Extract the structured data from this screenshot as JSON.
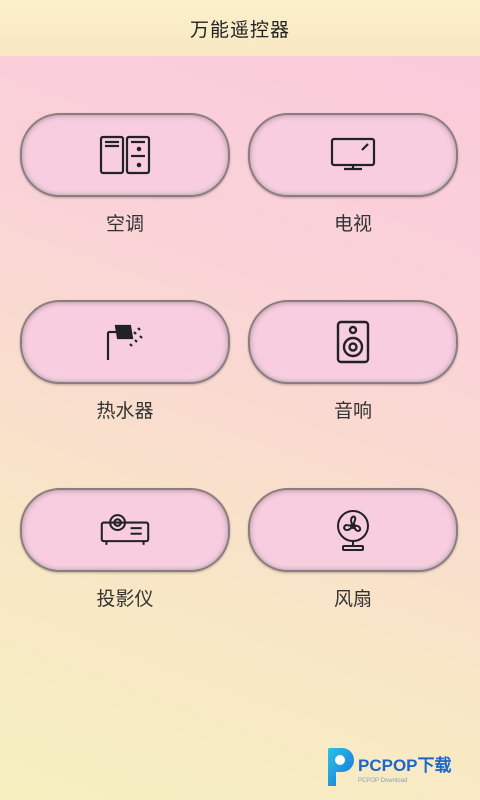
{
  "header": {
    "title": "万能遥控器"
  },
  "devices": [
    {
      "label": "空调",
      "icon": "air-conditioner-icon"
    },
    {
      "label": "电视",
      "icon": "tv-icon"
    },
    {
      "label": "热水器",
      "icon": "water-heater-icon"
    },
    {
      "label": "音响",
      "icon": "speaker-icon"
    },
    {
      "label": "投影仪",
      "icon": "projector-icon"
    },
    {
      "label": "风扇",
      "icon": "fan-icon"
    }
  ],
  "watermark": {
    "brand": "PCPOP下载",
    "sub": "PCPOP Download"
  },
  "colors": {
    "pill": "#f9cde0",
    "pill_border": "#8c7c80",
    "header": "#fbf0c9"
  }
}
